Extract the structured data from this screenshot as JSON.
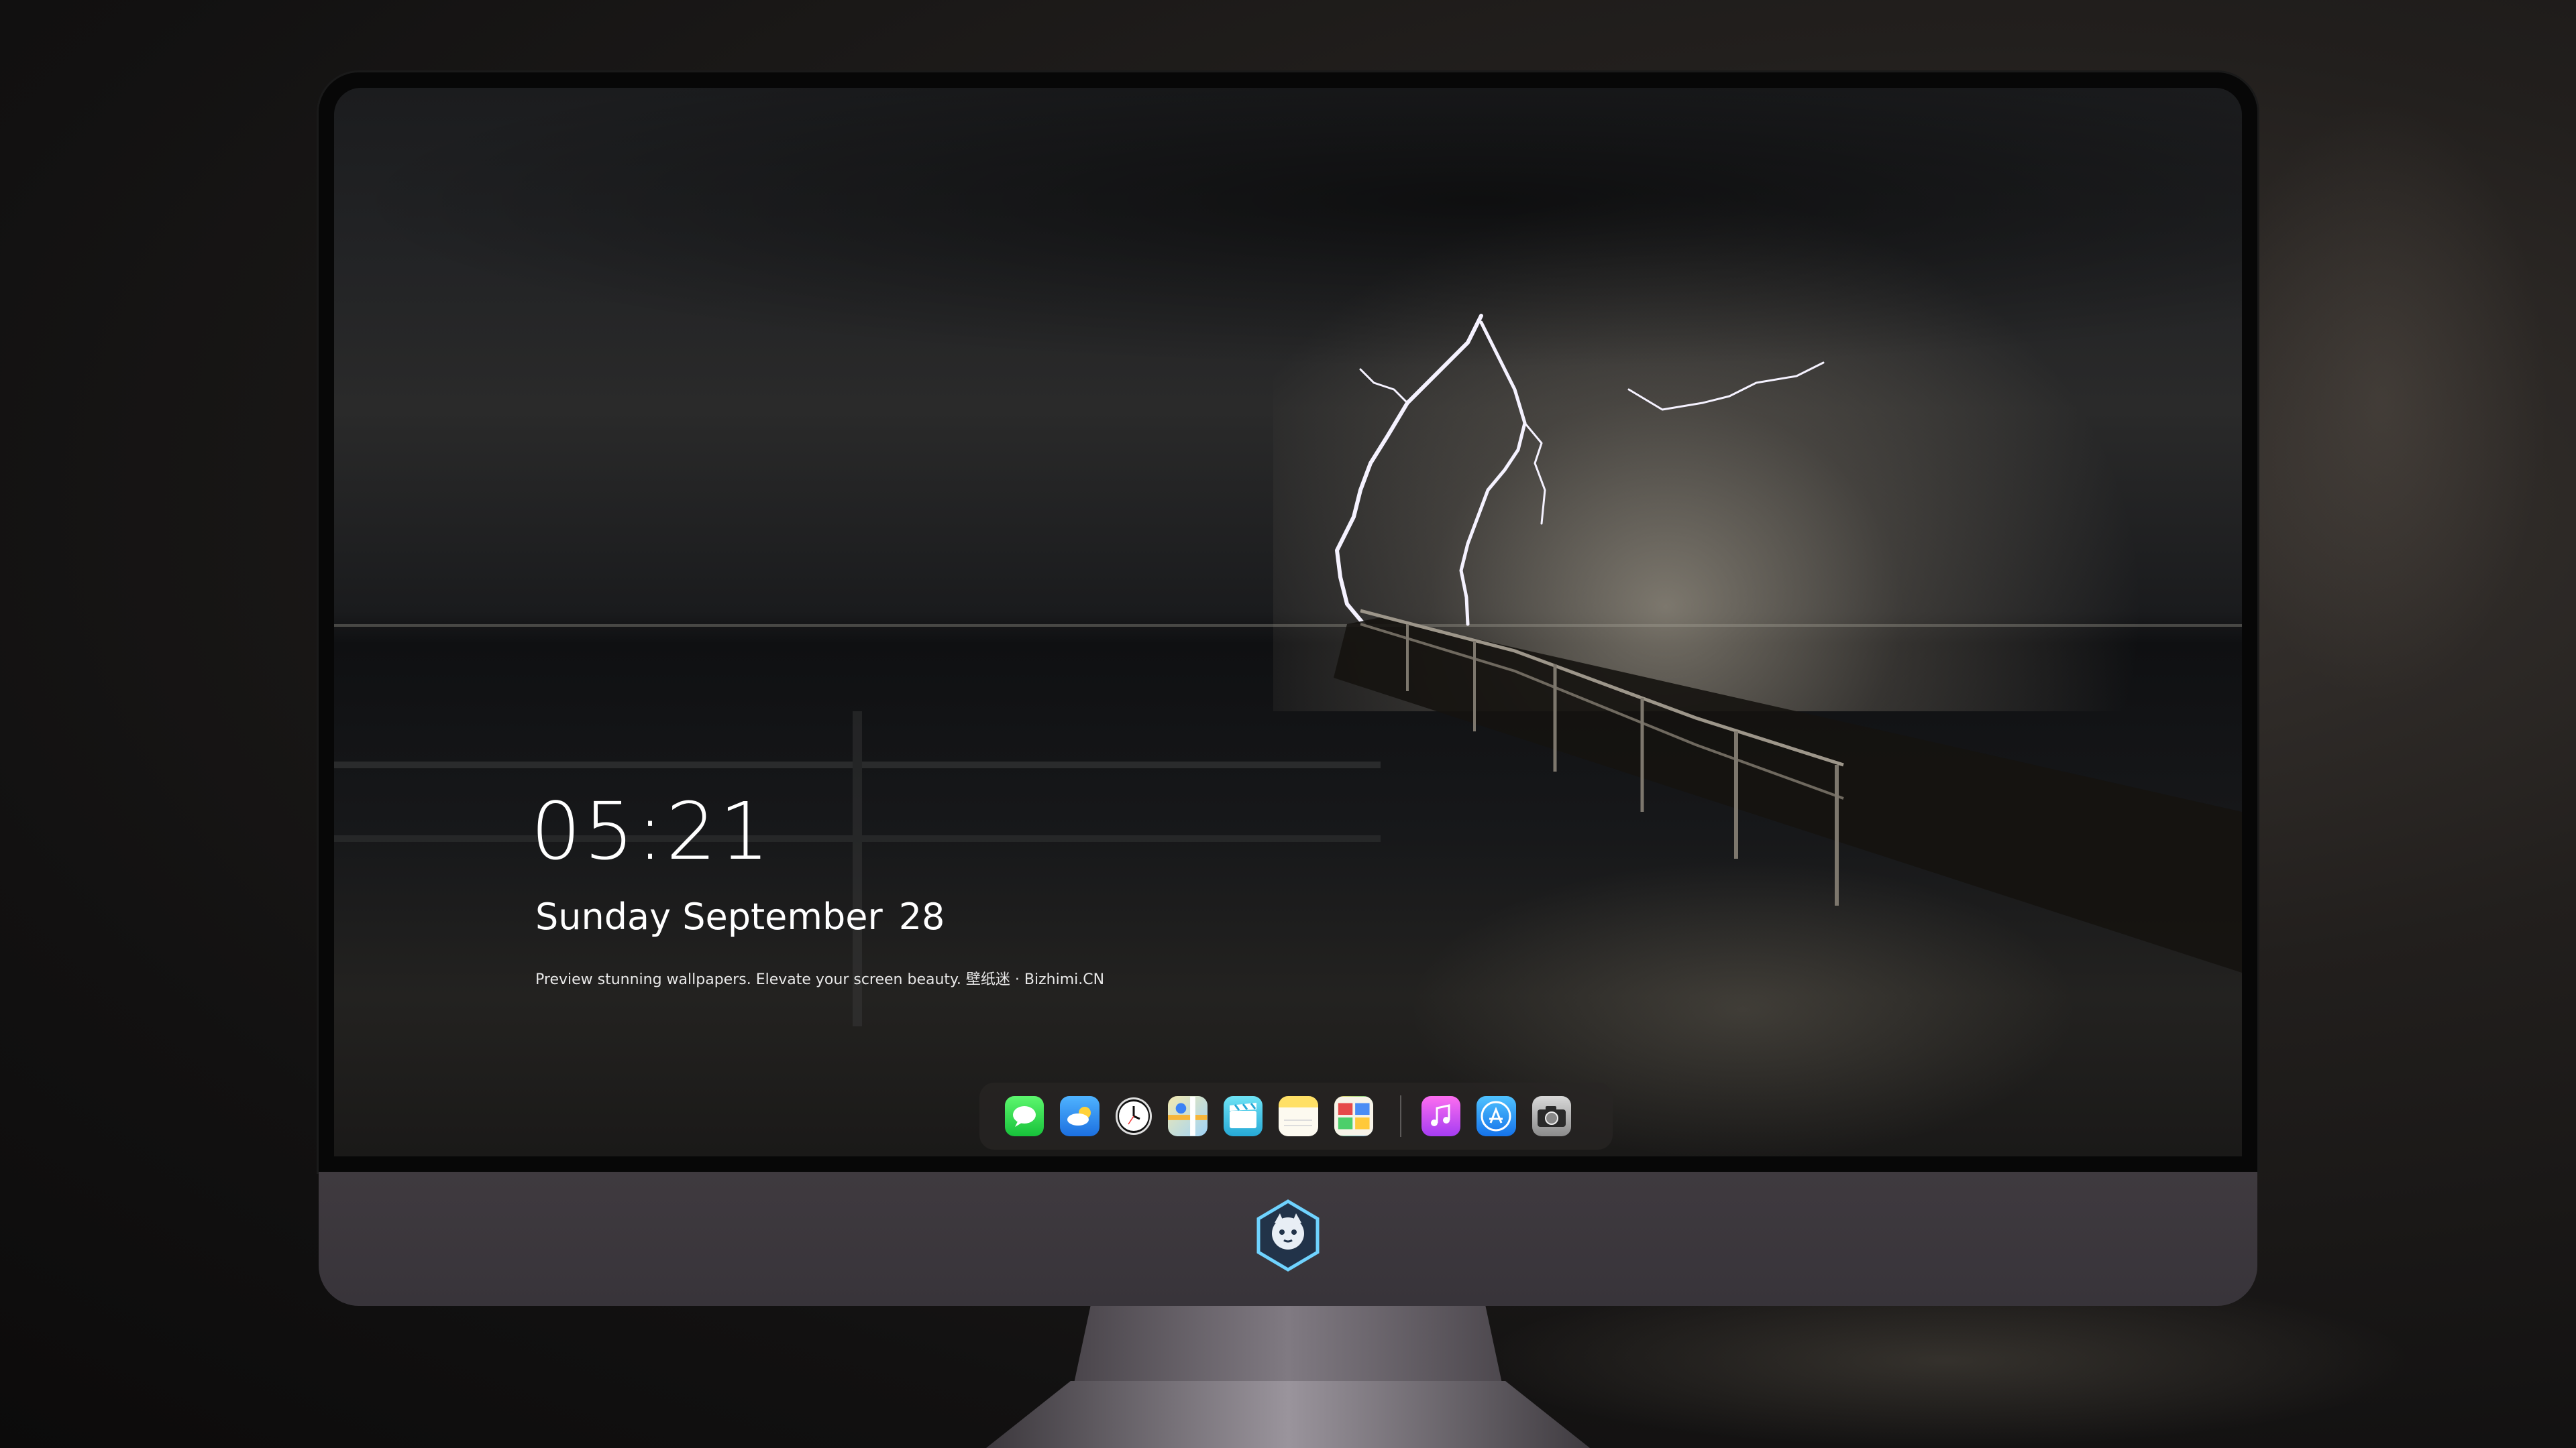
{
  "lock_screen": {
    "time": "05:21",
    "weekday_month": "Sunday September",
    "day": "28",
    "caption": "Preview stunning wallpapers. Elevate your screen beauty. 壁纸迷 · Bizhimi.CN"
  },
  "dock": {
    "items": [
      {
        "name": "messages-icon",
        "glyph": "💬"
      },
      {
        "name": "weather-icon",
        "glyph": "☁"
      },
      {
        "name": "clock-icon",
        "glyph": "🕒"
      },
      {
        "name": "maps-icon",
        "glyph": "🗺"
      },
      {
        "name": "clips-icon",
        "glyph": "🎬"
      },
      {
        "name": "notes-icon",
        "glyph": ""
      },
      {
        "name": "photos-icon",
        "glyph": "▦"
      },
      {
        "name": "music-icon",
        "glyph": "♫"
      },
      {
        "name": "app-store-icon",
        "glyph": "A"
      },
      {
        "name": "camera-icon",
        "glyph": "📷"
      }
    ]
  },
  "colors": {
    "text": "#ffffff",
    "chin": "#3f3a3f",
    "dock_bg": "rgba(40,38,36,0.72)"
  }
}
